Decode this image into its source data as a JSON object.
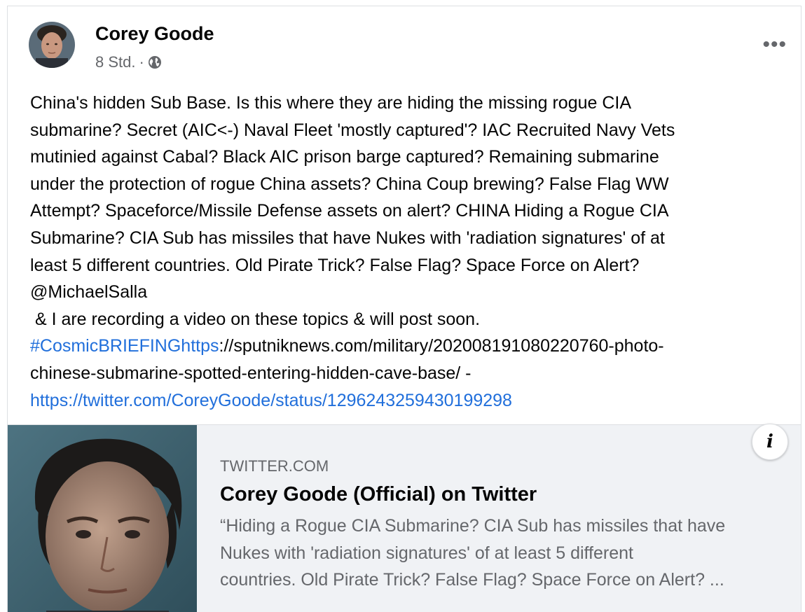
{
  "post": {
    "author": "Corey Goode",
    "time": "8 Std.",
    "separator": "·",
    "privacy_icon": "globe-icon",
    "more_label": "•••",
    "lines": [
      "China's hidden Sub Base. Is this where they are hiding the missing rogue CIA",
      "submarine? Secret (AIC<-) Naval Fleet 'mostly captured'? IAC Recruited Navy Vets",
      "mutinied against Cabal? Black AIC prison barge captured? Remaining submarine",
      "under the protection of rogue China assets? China Coup brewing? False Flag WW",
      "Attempt? Spaceforce/Missile Defense assets on alert? CHINA Hiding a Rogue CIA",
      "Submarine? CIA Sub has missiles that have Nukes with 'radiation signatures' of at",
      "least 5 different countries. Old Pirate Trick? False Flag? Space Force on Alert?",
      "@MichaelSalla",
      " & I are recording a video on these topics & will post soon."
    ],
    "hashtag": "#CosmicBRIEFINGhttps",
    "url_rest": "://sputniknews.com/military/202008191080220760-photo-",
    "url_line2": "chinese-submarine-spotted-entering-hidden-cave-base/ -",
    "twitter_url": "https://twitter.com/CoreyGoode/status/1296243259430199298"
  },
  "preview": {
    "domain": "TWITTER.COM",
    "title": "Corey Goode (Official) on Twitter",
    "desc": [
      "“Hiding a Rogue CIA Submarine? CIA Sub has missiles that have",
      "Nukes with 'radiation signatures' of at least 5 different",
      "countries. Old Pirate Trick? False Flag? Space Force on Alert? ..."
    ],
    "info_label": "i"
  },
  "colors": {
    "link": "#216fdb",
    "secondary_text": "#65676b",
    "preview_bg": "#f0f2f5"
  }
}
